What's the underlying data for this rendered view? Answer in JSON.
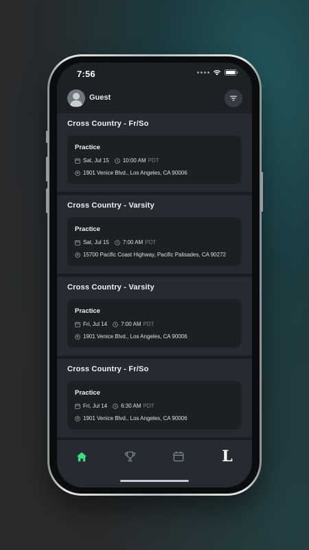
{
  "status_bar": {
    "time": "7:56"
  },
  "header": {
    "user_name": "Guest",
    "avatar_icon": "user-avatar-icon",
    "filter_icon": "filter-icon"
  },
  "events": [
    {
      "team": "Cross Country - Fr/So",
      "type": "Practice",
      "date": "Sat, Jul 15",
      "time": "10:00 AM",
      "tz": "PDT",
      "location": "1901 Venice Blvd., Los Angeles, CA 90006"
    },
    {
      "team": "Cross Country - Varsity",
      "type": "Practice",
      "date": "Sat, Jul 15",
      "time": "7:00 AM",
      "tz": "PDT",
      "location": "15700 Pacific Coast Highway, Pacific Palisades, CA 90272"
    },
    {
      "team": "Cross Country - Varsity",
      "type": "Practice",
      "date": "Fri, Jul 14",
      "time": "7:00 AM",
      "tz": "PDT",
      "location": "1901 Venice Blvd., Los Angeles, CA 90006"
    },
    {
      "team": "Cross Country - Fr/So",
      "type": "Practice",
      "date": "Fri, Jul 14",
      "time": "6:30 AM",
      "tz": "PDT",
      "location": "1901 Venice Blvd., Los Angeles, CA 90006"
    }
  ],
  "tab_bar": {
    "tabs": [
      {
        "icon": "home-icon",
        "active": true
      },
      {
        "icon": "trophy-icon",
        "active": false
      },
      {
        "icon": "calendar-icon",
        "active": false
      },
      {
        "icon": "logo-l-icon",
        "active": false,
        "glyph": "L"
      }
    ]
  },
  "colors": {
    "accent": "#3ddc84",
    "background": "#1d2125",
    "section": "#262b31",
    "card": "#1c2024"
  }
}
